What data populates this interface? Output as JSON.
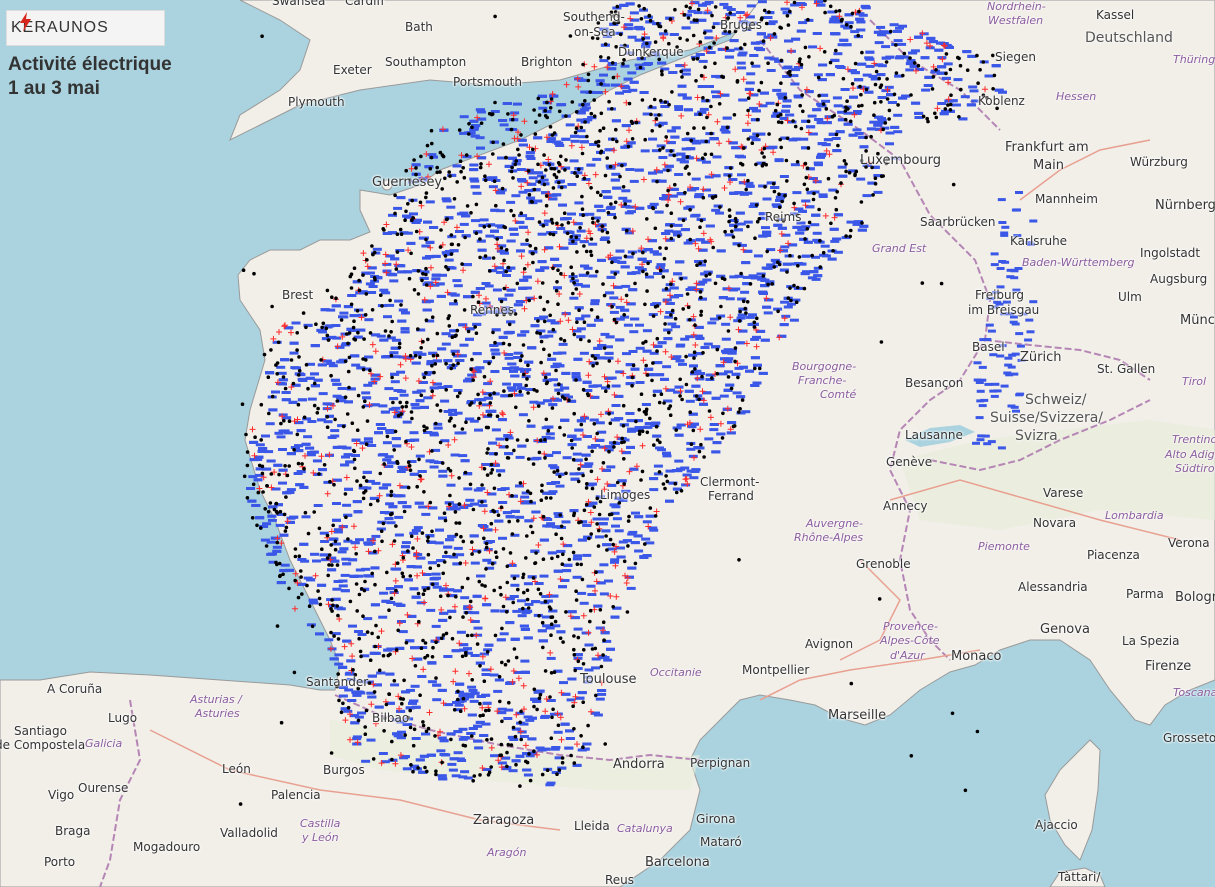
{
  "brand": {
    "name": "KERAUNOS",
    "accent": "#d9261c"
  },
  "title": {
    "line1": "Activité électrique",
    "line2": "1 au 3 mai"
  },
  "legend_colors": {
    "intracloud": "#3a57e8",
    "positive": "#ff2a2a",
    "negative": "#000000"
  },
  "labels": [
    {
      "t": "Swansea",
      "c": "city"
    },
    {
      "t": "Cardiff",
      "c": "city"
    },
    {
      "t": "Bath",
      "c": "city"
    },
    {
      "t": "Southend-",
      "c": "city"
    },
    {
      "t": "on-Sea",
      "c": "city"
    },
    {
      "t": "Exeter",
      "c": "city"
    },
    {
      "t": "Southampton",
      "c": "city"
    },
    {
      "t": "Brighton",
      "c": "city"
    },
    {
      "t": "Portsmouth",
      "c": "city"
    },
    {
      "t": "Plymouth",
      "c": "city"
    },
    {
      "t": "Dunkerque",
      "c": "city"
    },
    {
      "t": "Bruges",
      "c": "city"
    },
    {
      "t": "Nordrhein-",
      "c": "region"
    },
    {
      "t": "Westfalen",
      "c": "region"
    },
    {
      "t": "Kassel",
      "c": "city"
    },
    {
      "t": "Deutschland",
      "c": "country"
    },
    {
      "t": "Thüringen",
      "c": "region"
    },
    {
      "t": "Siegen",
      "c": "city"
    },
    {
      "t": "Koblenz",
      "c": "city"
    },
    {
      "t": "Hessen",
      "c": "region"
    },
    {
      "t": "Frankfurt am",
      "c": "city-l"
    },
    {
      "t": "Main",
      "c": "city-l"
    },
    {
      "t": "Würzburg",
      "c": "city"
    },
    {
      "t": "Nürnberg",
      "c": "city-l"
    },
    {
      "t": "Luxembourg",
      "c": "city-l"
    },
    {
      "t": "Saarbrücken",
      "c": "city"
    },
    {
      "t": "Mannheim",
      "c": "city"
    },
    {
      "t": "Karlsruhe",
      "c": "city"
    },
    {
      "t": "Ingolstadt",
      "c": "city"
    },
    {
      "t": "Baden-Württemberg",
      "c": "region"
    },
    {
      "t": "Augsburg",
      "c": "city"
    },
    {
      "t": "Ulm",
      "c": "city"
    },
    {
      "t": "München",
      "c": "city-l"
    },
    {
      "t": "Guernesey",
      "c": "city-l"
    },
    {
      "t": "Reims",
      "c": "city"
    },
    {
      "t": "Grand Est",
      "c": "region"
    },
    {
      "t": "Brest",
      "c": "city"
    },
    {
      "t": "Rennes",
      "c": "city"
    },
    {
      "t": "Freiburg",
      "c": "city"
    },
    {
      "t": "im Breisgau",
      "c": "city"
    },
    {
      "t": "Basel",
      "c": "city"
    },
    {
      "t": "Zürich",
      "c": "city-l"
    },
    {
      "t": "St. Gallen",
      "c": "city"
    },
    {
      "t": "Tirol",
      "c": "region"
    },
    {
      "t": "Bourgogne-",
      "c": "region"
    },
    {
      "t": "Franche-",
      "c": "region"
    },
    {
      "t": "Comté",
      "c": "region"
    },
    {
      "t": "Besançon",
      "c": "city"
    },
    {
      "t": "Schweiz/",
      "c": "country"
    },
    {
      "t": "Suisse/Svizzera/",
      "c": "country"
    },
    {
      "t": "Svizra",
      "c": "country"
    },
    {
      "t": "Lausanne",
      "c": "city"
    },
    {
      "t": "Trentino-",
      "c": "region"
    },
    {
      "t": "Alto Adige/",
      "c": "region"
    },
    {
      "t": "Südtirol",
      "c": "region"
    },
    {
      "t": "Genève",
      "c": "city"
    },
    {
      "t": "Clermont-",
      "c": "city"
    },
    {
      "t": "Ferrand",
      "c": "city"
    },
    {
      "t": "Annecy",
      "c": "city"
    },
    {
      "t": "Varese",
      "c": "city"
    },
    {
      "t": "Auvergne-",
      "c": "region"
    },
    {
      "t": "Rhône-Alpes",
      "c": "region"
    },
    {
      "t": "Novara",
      "c": "city"
    },
    {
      "t": "Lombardia",
      "c": "region"
    },
    {
      "t": "Verona",
      "c": "city"
    },
    {
      "t": "Limoges",
      "c": "city"
    },
    {
      "t": "Piemonte",
      "c": "region"
    },
    {
      "t": "Grenoble",
      "c": "city"
    },
    {
      "t": "Piacenza",
      "c": "city"
    },
    {
      "t": "Alessandria",
      "c": "city"
    },
    {
      "t": "Parma",
      "c": "city"
    },
    {
      "t": "Bologna",
      "c": "city-l"
    },
    {
      "t": "Genova",
      "c": "city-l"
    },
    {
      "t": "La Spezia",
      "c": "city"
    },
    {
      "t": "Provence-",
      "c": "region"
    },
    {
      "t": "Alpes-Côte",
      "c": "region"
    },
    {
      "t": "d'Azur",
      "c": "region"
    },
    {
      "t": "Avignon",
      "c": "city"
    },
    {
      "t": "Monaco",
      "c": "city-l"
    },
    {
      "t": "Firenze",
      "c": "city-l"
    },
    {
      "t": "Toscana",
      "c": "region"
    },
    {
      "t": "Montpellier",
      "c": "city"
    },
    {
      "t": "Occitanie",
      "c": "region"
    },
    {
      "t": "Toulouse",
      "c": "city-l"
    },
    {
      "t": "Marseille",
      "c": "city-l"
    },
    {
      "t": "Grosseto",
      "c": "city"
    },
    {
      "t": "A Coruña",
      "c": "city"
    },
    {
      "t": "Santander",
      "c": "city"
    },
    {
      "t": "Bilbao",
      "c": "city"
    },
    {
      "t": "Asturias /",
      "c": "region"
    },
    {
      "t": "Asturies",
      "c": "region"
    },
    {
      "t": "Lugo",
      "c": "city"
    },
    {
      "t": "Santiago",
      "c": "city"
    },
    {
      "t": "de Compostela",
      "c": "city"
    },
    {
      "t": "Galicia",
      "c": "region"
    },
    {
      "t": "Ourense",
      "c": "city"
    },
    {
      "t": "León",
      "c": "city"
    },
    {
      "t": "Burgos",
      "c": "city"
    },
    {
      "t": "Vigo",
      "c": "city"
    },
    {
      "t": "Palencia",
      "c": "city"
    },
    {
      "t": "Andorra",
      "c": "city-l"
    },
    {
      "t": "Perpignan",
      "c": "city"
    },
    {
      "t": "Braga",
      "c": "city"
    },
    {
      "t": "Valladolid",
      "c": "city"
    },
    {
      "t": "Castilla",
      "c": "region"
    },
    {
      "t": "y León",
      "c": "region"
    },
    {
      "t": "Zaragoza",
      "c": "city-l"
    },
    {
      "t": "Lleida",
      "c": "city"
    },
    {
      "t": "Catalunya",
      "c": "region"
    },
    {
      "t": "Girona",
      "c": "city"
    },
    {
      "t": "Ajaccio",
      "c": "city"
    },
    {
      "t": "Porto",
      "c": "city"
    },
    {
      "t": "Mogadouro",
      "c": "city"
    },
    {
      "t": "Aragón",
      "c": "region"
    },
    {
      "t": "Mataró",
      "c": "city"
    },
    {
      "t": "Barcelona",
      "c": "city-l"
    },
    {
      "t": "Reus",
      "c": "city"
    },
    {
      "t": "Tàttari/",
      "c": "city"
    }
  ]
}
